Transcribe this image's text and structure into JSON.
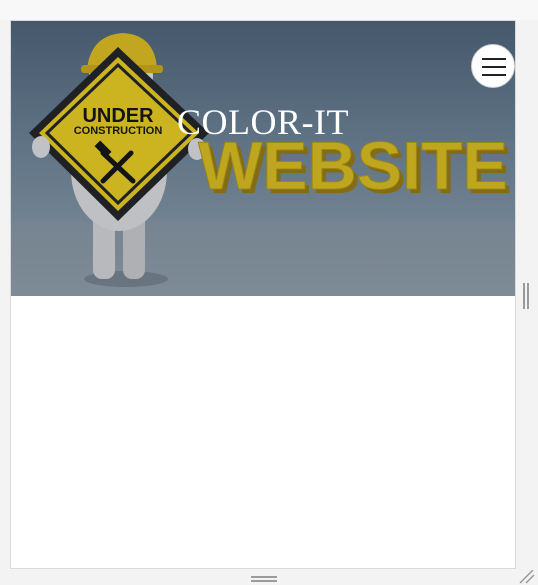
{
  "header": {
    "title": "COLOR-IT"
  },
  "hero": {
    "sign_line1": "UNDER",
    "sign_line2": "CONSTRUCTION",
    "banner_word": "WEBSITE"
  },
  "colors": {
    "sign_yellow": "#f2d31b",
    "banner_yellow": "#e3c21a",
    "hero_sky": "#6f8597"
  },
  "icons": {
    "menu": "hamburger-icon",
    "sign_tools": "hammer-wrench-icon"
  }
}
